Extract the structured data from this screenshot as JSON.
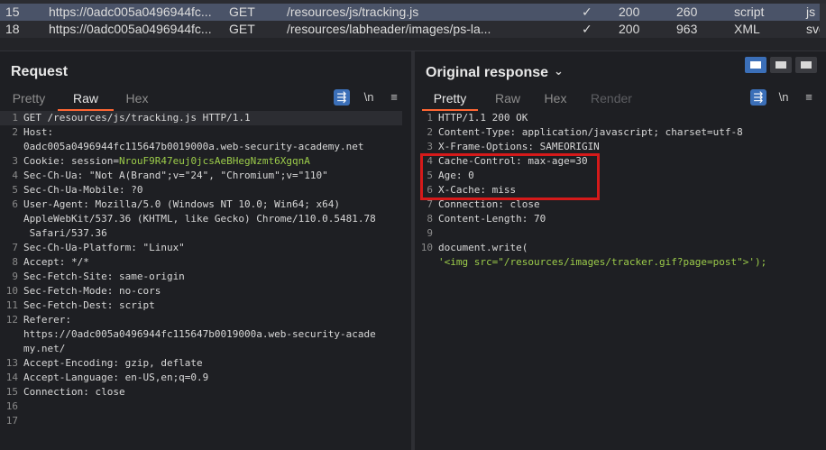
{
  "history": {
    "rows": [
      {
        "num": "15",
        "host": "https://0adc005a0496944fc...",
        "method": "GET",
        "url": "/resources/js/tracking.js",
        "check": "✓",
        "status": "200",
        "length": "260",
        "mime": "script",
        "ext": "js"
      },
      {
        "num": "18",
        "host": "https://0adc005a0496944fc...",
        "method": "GET",
        "url": "/resources/labheader/images/ps-la...",
        "check": "✓",
        "status": "200",
        "length": "963",
        "mime": "XML",
        "ext": "svg"
      }
    ]
  },
  "request": {
    "title": "Request",
    "tabs": [
      "Pretty",
      "Raw",
      "Hex"
    ],
    "active_tab": "Raw",
    "newline_label": "\\n",
    "menu_glyph": "≡",
    "lines": [
      {
        "n": "1",
        "t": "GET /resources/js/tracking.js HTTP/1.1"
      },
      {
        "n": "2",
        "t": "Host:"
      },
      {
        "n": "",
        "t": "0adc005a0496944fc115647b0019000a.web-security-academy.net"
      },
      {
        "n": "3",
        "t": "Cookie: session=",
        "extra": "NrouF9R47euj0jcsAeBHegNzmt6XgqnA"
      },
      {
        "n": "4",
        "t": "Sec-Ch-Ua: \"Not A(Brand\";v=\"24\", \"Chromium\";v=\"110\""
      },
      {
        "n": "5",
        "t": "Sec-Ch-Ua-Mobile: ?0"
      },
      {
        "n": "6",
        "t": "User-Agent: Mozilla/5.0 (Windows NT 10.0; Win64; x64)"
      },
      {
        "n": "",
        "t": "AppleWebKit/537.36 (KHTML, like Gecko) Chrome/110.0.5481.78"
      },
      {
        "n": "",
        "t": " Safari/537.36"
      },
      {
        "n": "7",
        "t": "Sec-Ch-Ua-Platform: \"Linux\""
      },
      {
        "n": "8",
        "t": "Accept: */*"
      },
      {
        "n": "9",
        "t": "Sec-Fetch-Site: same-origin"
      },
      {
        "n": "10",
        "t": "Sec-Fetch-Mode: no-cors"
      },
      {
        "n": "11",
        "t": "Sec-Fetch-Dest: script"
      },
      {
        "n": "12",
        "t": "Referer:"
      },
      {
        "n": "",
        "t": "https://0adc005a0496944fc115647b0019000a.web-security-acade"
      },
      {
        "n": "",
        "t": "my.net/"
      },
      {
        "n": "13",
        "t": "Accept-Encoding: gzip, deflate"
      },
      {
        "n": "14",
        "t": "Accept-Language: en-US,en;q=0.9"
      },
      {
        "n": "15",
        "t": "Connection: close"
      },
      {
        "n": "16",
        "t": ""
      },
      {
        "n": "17",
        "t": ""
      }
    ]
  },
  "response": {
    "title": "Original response",
    "title_chevron": "⌄",
    "tabs": [
      "Pretty",
      "Raw",
      "Hex",
      "Render"
    ],
    "active_tab": "Pretty",
    "newline_label": "\\n",
    "menu_glyph": "≡",
    "lines": [
      {
        "n": "1",
        "t": "HTTP/1.1 200 OK"
      },
      {
        "n": "2",
        "t": "Content-Type: application/javascript; charset=utf-8"
      },
      {
        "n": "3",
        "t": "X-Frame-Options: SAMEORIGIN"
      },
      {
        "n": "4",
        "t": "Cache-Control: max-age=30"
      },
      {
        "n": "5",
        "t": "Age: 0"
      },
      {
        "n": "6",
        "t": "X-Cache: miss"
      },
      {
        "n": "7",
        "t": "Connection: close"
      },
      {
        "n": "8",
        "t": "Content-Length: 70"
      },
      {
        "n": "9",
        "t": ""
      },
      {
        "n": "10",
        "t": "document.write("
      },
      {
        "n": "",
        "t": "'<img src=\"/resources/images/tracker.gif?page=post\">');",
        "str": true
      }
    ]
  },
  "colors": {
    "accent": "#ff6633",
    "selected_row": "#4a5368",
    "highlight_box": "#d51a1a",
    "session_value": "#9ccc4a"
  }
}
